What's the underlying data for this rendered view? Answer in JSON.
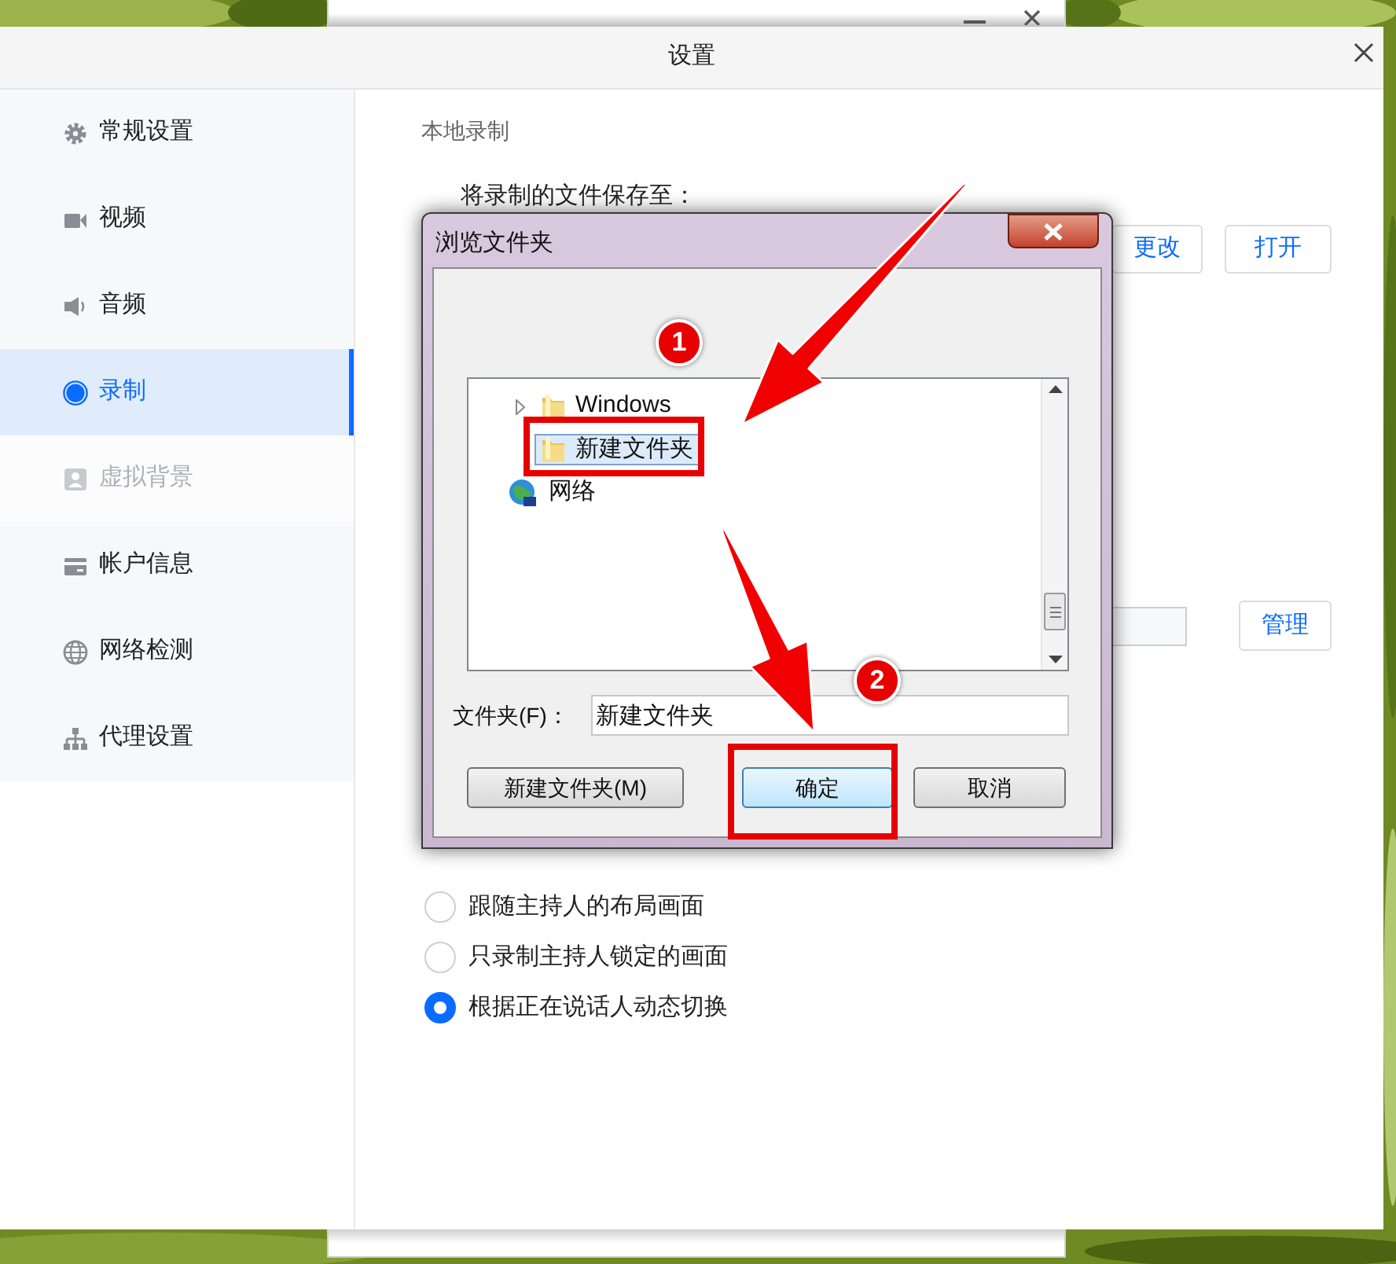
{
  "window": {
    "title": "设置"
  },
  "sidebar": {
    "items": [
      {
        "label": "常规设置",
        "selected": false,
        "disabled": false
      },
      {
        "label": "视频",
        "selected": false,
        "disabled": false
      },
      {
        "label": "音频",
        "selected": false,
        "disabled": false
      },
      {
        "label": "录制",
        "selected": true,
        "disabled": false
      },
      {
        "label": "虚拟背景",
        "selected": false,
        "disabled": true
      },
      {
        "label": "帐户信息",
        "selected": false,
        "disabled": false
      },
      {
        "label": "网络检测",
        "selected": false,
        "disabled": false
      },
      {
        "label": "代理设置",
        "selected": false,
        "disabled": false
      }
    ]
  },
  "content": {
    "section_title": "本地录制",
    "save_label": "将录制的文件保存至：",
    "change_button": "更改",
    "open_button": "打开",
    "manage_button": "管理",
    "layout_options": [
      {
        "label": "跟随主持人的布局画面",
        "selected": false
      },
      {
        "label": "只录制主持人锁定的画面",
        "selected": false
      },
      {
        "label": "根据正在说话人动态切换",
        "selected": true
      }
    ]
  },
  "dialog": {
    "title": "浏览文件夹",
    "tree": [
      {
        "label": "Windows",
        "kind": "folder",
        "expandable": true,
        "selected": false
      },
      {
        "label": "新建文件夹",
        "kind": "folder",
        "expandable": false,
        "selected": true
      },
      {
        "label": "网络",
        "kind": "network",
        "expandable": false,
        "selected": false
      }
    ],
    "folder_label": "文件夹(F)：",
    "folder_value": "新建文件夹",
    "buttons": [
      {
        "label": "新建文件夹(M)",
        "default": false
      },
      {
        "label": "确定",
        "default": true
      },
      {
        "label": "取消",
        "default": false
      }
    ]
  },
  "annotations": [
    {
      "kind": "badge",
      "label": "1"
    },
    {
      "kind": "badge",
      "label": "2"
    }
  ]
}
